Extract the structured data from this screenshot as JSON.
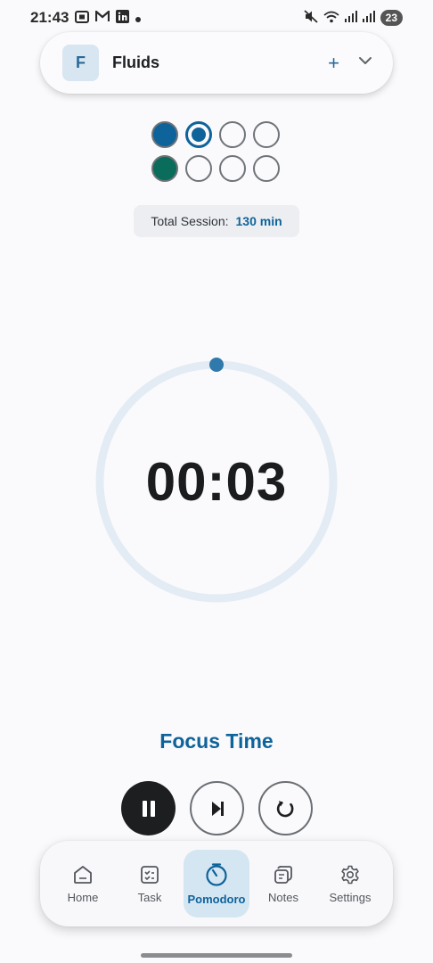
{
  "status_bar": {
    "time": "21:43",
    "left_icons": [
      "screenshot-icon",
      "gmail-icon",
      "linkedin-icon",
      "dot-icon"
    ],
    "right_icons": [
      "mute-icon",
      "wifi-icon",
      "signal-icon",
      "signal-icon"
    ],
    "battery": "23"
  },
  "project": {
    "avatar_letter": "F",
    "name": "Fluids",
    "add_label": "+"
  },
  "sessions": {
    "focus_row": [
      "done",
      "active",
      "empty",
      "empty"
    ],
    "break_row": [
      "done",
      "empty",
      "empty",
      "empty"
    ],
    "total_label": "Total Session:",
    "total_value": "130 min"
  },
  "timer": {
    "display": "00:03",
    "progress": 0.0,
    "mode_label": "Focus Time"
  },
  "controls": {
    "pause": "pause-icon",
    "skip": "skip-next-icon",
    "reset": "reset-icon"
  },
  "nav": {
    "items": [
      {
        "label": "Home",
        "icon": "home-icon"
      },
      {
        "label": "Task",
        "icon": "task-icon"
      },
      {
        "label": "Pomodoro",
        "icon": "timer-icon",
        "active": true
      },
      {
        "label": "Notes",
        "icon": "notes-icon"
      },
      {
        "label": "Settings",
        "icon": "gear-icon"
      }
    ]
  },
  "colors": {
    "accent": "#0e639a",
    "break_accent": "#0a6c5a",
    "ring_track": "#e3ecf4"
  }
}
